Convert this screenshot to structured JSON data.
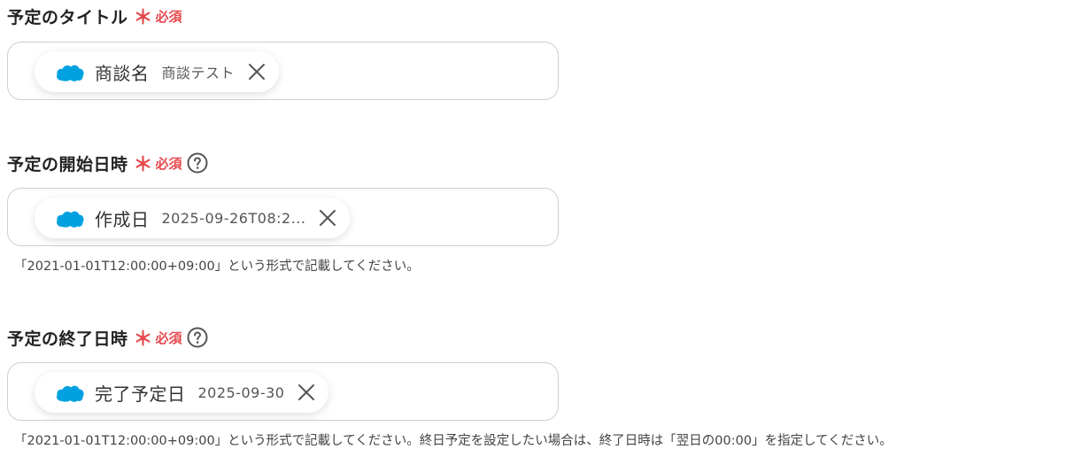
{
  "fields": [
    {
      "label": "予定のタイトル",
      "required_mark": "＊",
      "required_text": "必須",
      "has_help": false,
      "chip": {
        "icon": "salesforce-cloud-icon",
        "name": "商談名",
        "value": "商談テスト"
      },
      "hint": ""
    },
    {
      "label": "予定の開始日時",
      "required_mark": "＊",
      "required_text": "必須",
      "has_help": true,
      "chip": {
        "icon": "salesforce-cloud-icon",
        "name": "作成日",
        "value": "2025-09-26T08:2..."
      },
      "hint": "「2021-01-01T12:00:00+09:00」という形式で記載してください。"
    },
    {
      "label": "予定の終了日時",
      "required_mark": "＊",
      "required_text": "必須",
      "has_help": true,
      "chip": {
        "icon": "salesforce-cloud-icon",
        "name": "完了予定日",
        "value": "2025-09-30"
      },
      "hint": "「2021-01-01T12:00:00+09:00」という形式で記載してください。終日予定を設定したい場合は、終了日時は「翌日の00:00」を指定してください。"
    }
  ],
  "colors": {
    "required": "#e5484d",
    "salesforce_blue": "#00a1e0",
    "border": "#cfcfd4"
  }
}
